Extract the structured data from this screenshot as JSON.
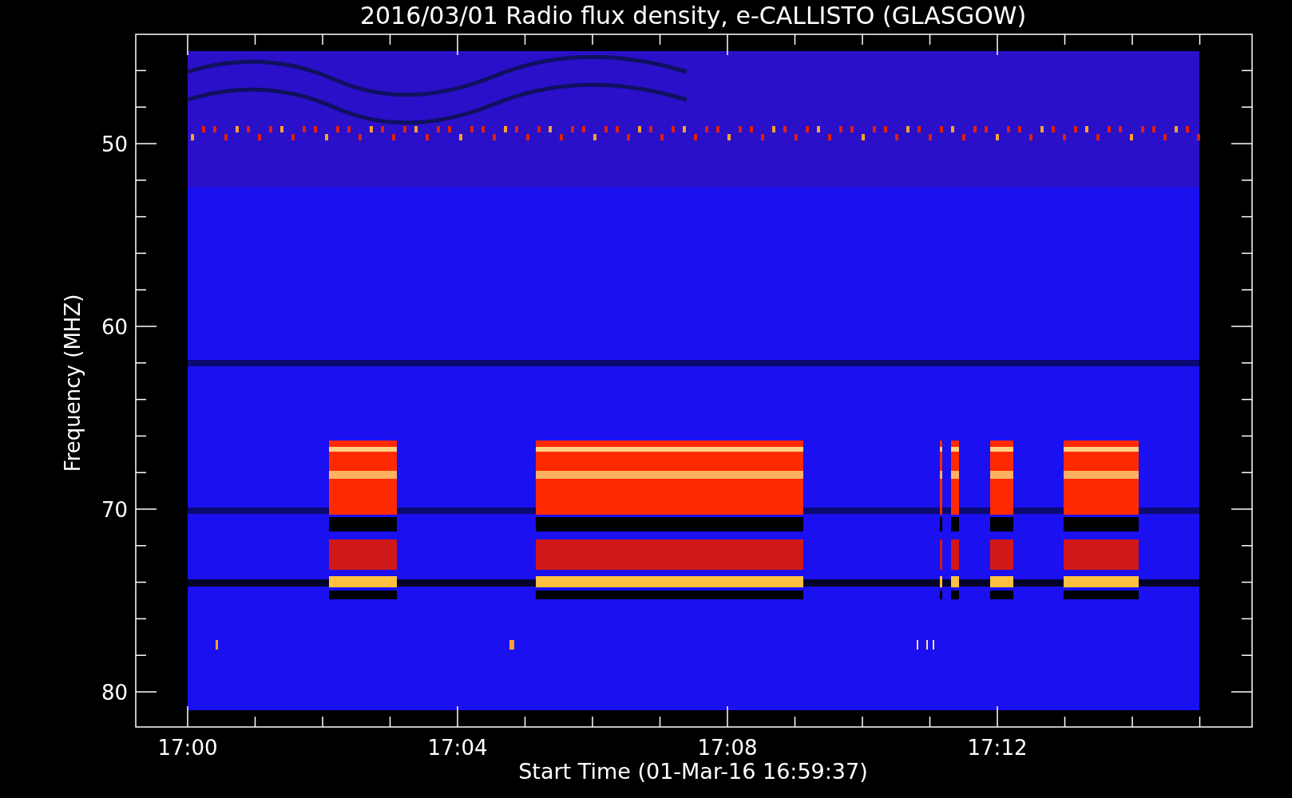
{
  "title": "2016/03/01  Radio flux density, e-CALLISTO (GLASGOW)",
  "y_axis": {
    "label": "Frequency (MHZ)",
    "ticks": [
      "50",
      "60",
      "70",
      "80"
    ]
  },
  "x_axis": {
    "label": "Start Time (01-Mar-16 16:59:37)",
    "ticks": [
      "17:00",
      "17:04",
      "17:08",
      "17:12"
    ]
  }
}
